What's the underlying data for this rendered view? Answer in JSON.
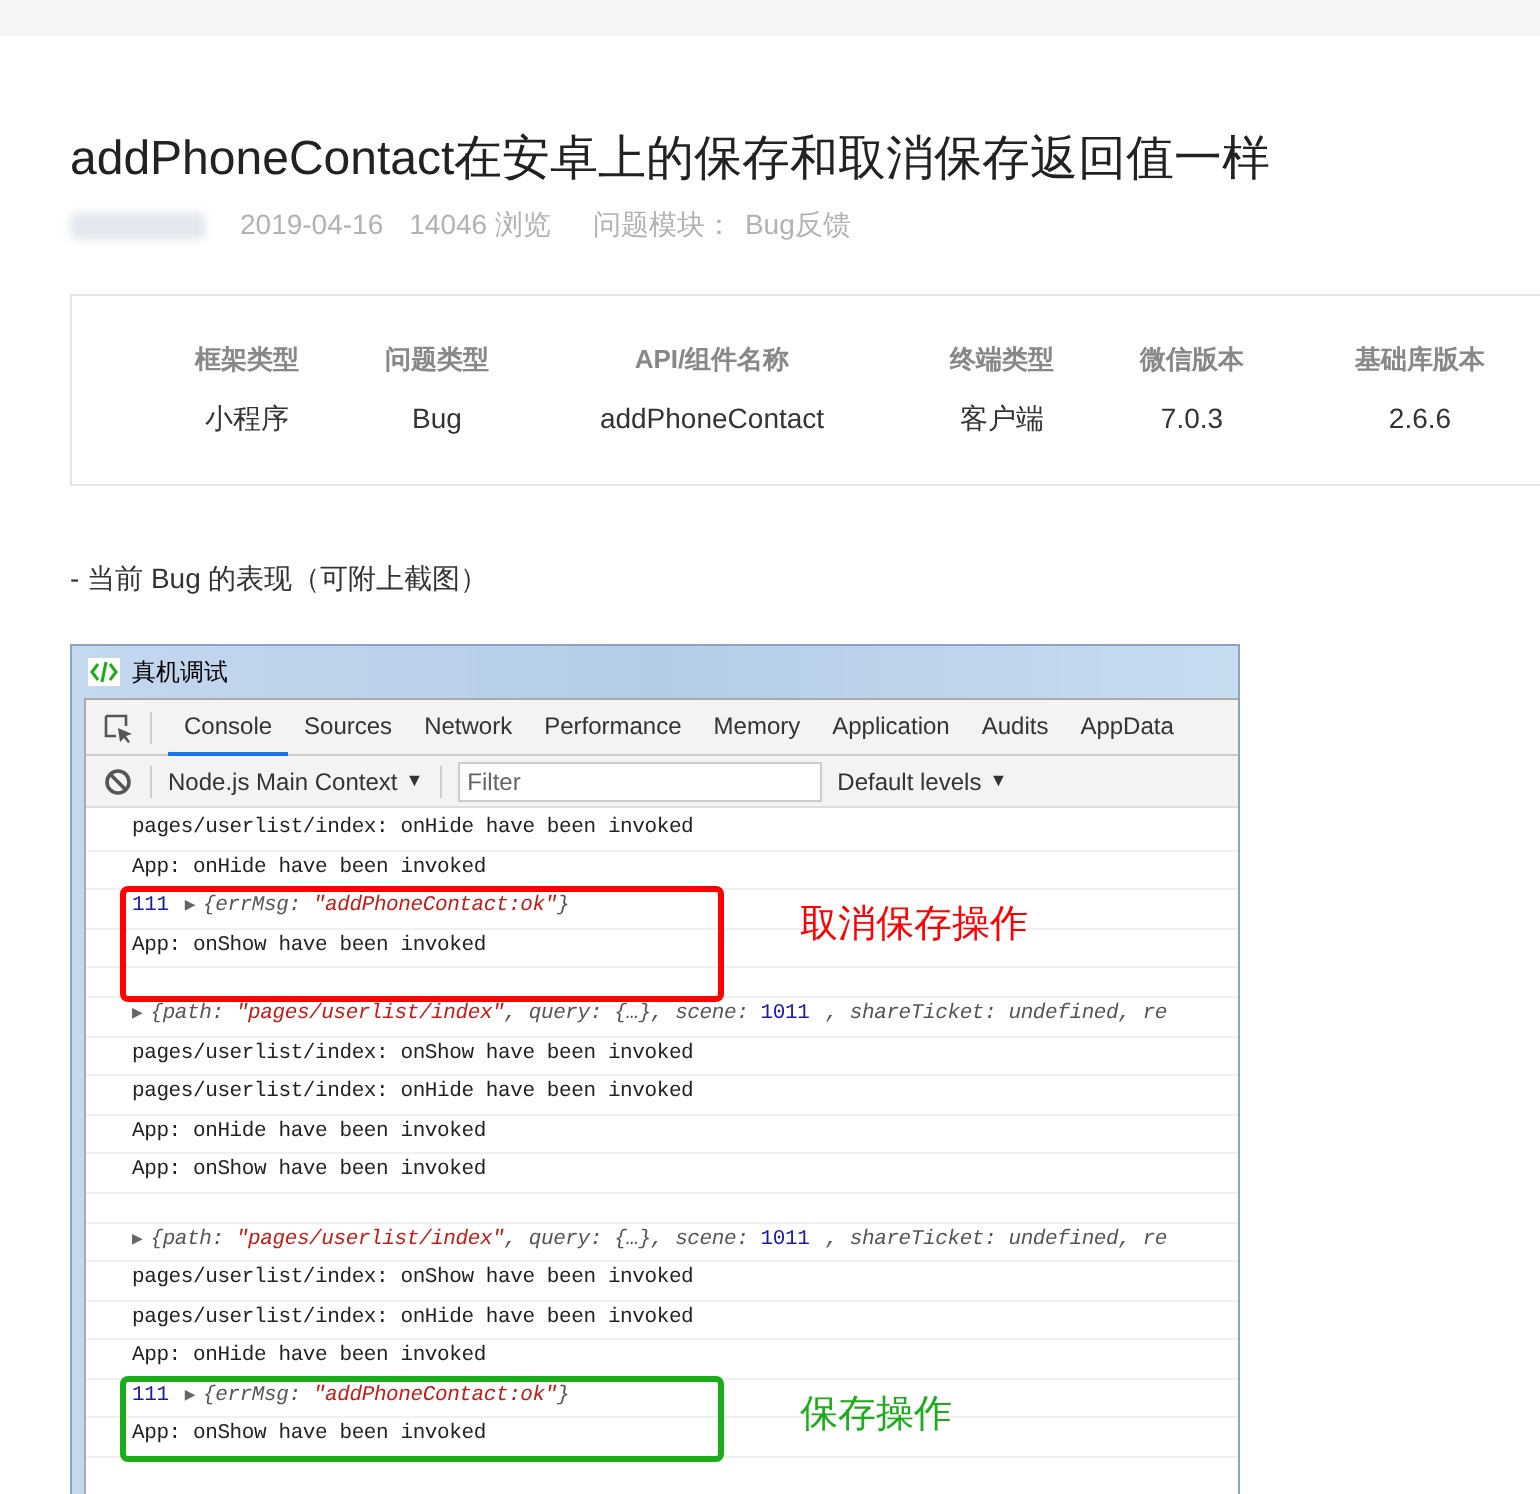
{
  "title": "addPhoneContact在安卓上的保存和取消保存返回值一样",
  "meta": {
    "date": "2019-04-16",
    "views": "14046 浏览",
    "module_label": "问题模块：",
    "module": "Bug反馈"
  },
  "info": [
    {
      "label": "框架类型",
      "value": "小程序"
    },
    {
      "label": "问题类型",
      "value": "Bug"
    },
    {
      "label": "API/组件名称",
      "value": "addPhoneContact"
    },
    {
      "label": "终端类型",
      "value": "客户端"
    },
    {
      "label": "微信版本",
      "value": "7.0.3"
    },
    {
      "label": "基础库版本",
      "value": "2.6.6"
    }
  ],
  "section": "- 当前 Bug 的表现（可附上截图）",
  "devtools": {
    "title": "真机调试",
    "tabs": [
      {
        "label": "Console",
        "selected": true
      },
      {
        "label": "Sources",
        "selected": false
      },
      {
        "label": "Network",
        "selected": false
      },
      {
        "label": "Performance",
        "selected": false
      },
      {
        "label": "Memory",
        "selected": false
      },
      {
        "label": "Application",
        "selected": false
      },
      {
        "label": "Audits",
        "selected": false
      },
      {
        "label": "AppData",
        "selected": false
      }
    ],
    "context": "Node.js Main Context",
    "dropdown_caret": "▼",
    "filter_placeholder": "Filter",
    "levels": "Default levels",
    "groups": [
      {
        "lines": [
          {
            "kind": "text",
            "segments": [
              {
                "kind": "plain",
                "text": "pages/userlist/index: onHide have been invoked"
              }
            ]
          },
          {
            "kind": "text",
            "segments": [
              {
                "kind": "plain",
                "text": "App: onHide have been invoked"
              }
            ]
          }
        ]
      },
      {
        "annotation": {
          "color": "#ff0000",
          "label": "取消保存操作"
        },
        "lines": [
          {
            "kind": "object",
            "segments": [
              {
                "kind": "number",
                "text": "111"
              },
              {
                "kind": "arrow",
                "text": "▶"
              },
              {
                "kind": "key",
                "text": "{errMsg: "
              },
              {
                "kind": "string",
                "text": "\"addPhoneContact:ok\""
              },
              {
                "kind": "key",
                "text": "}"
              }
            ]
          },
          {
            "kind": "text",
            "segments": [
              {
                "kind": "plain",
                "text": "App: onShow have been invoked"
              }
            ]
          },
          {
            "kind": "blank"
          }
        ]
      },
      {
        "lines": [
          {
            "kind": "object",
            "segments": [
              {
                "kind": "arrow",
                "text": "▶"
              },
              {
                "kind": "key",
                "text": "{path: "
              },
              {
                "kind": "string",
                "text": "\"pages/userlist/index\""
              },
              {
                "kind": "key",
                "text": ", query: {…}, scene: "
              },
              {
                "kind": "number",
                "text": "1011"
              },
              {
                "kind": "key",
                "text": ", shareTicket: undefined, re"
              }
            ]
          },
          {
            "kind": "text",
            "segments": [
              {
                "kind": "plain",
                "text": "pages/userlist/index: onShow have been invoked"
              }
            ]
          },
          {
            "kind": "text",
            "segments": [
              {
                "kind": "plain",
                "text": "pages/userlist/index: onHide have been invoked"
              }
            ]
          },
          {
            "kind": "text",
            "segments": [
              {
                "kind": "plain",
                "text": "App: onHide have been invoked"
              }
            ]
          },
          {
            "kind": "text",
            "segments": [
              {
                "kind": "plain",
                "text": "App: onShow have been invoked"
              }
            ]
          },
          {
            "kind": "blank"
          },
          {
            "kind": "object",
            "segments": [
              {
                "kind": "arrow",
                "text": "▶"
              },
              {
                "kind": "key",
                "text": "{path: "
              },
              {
                "kind": "string",
                "text": "\"pages/userlist/index\""
              },
              {
                "kind": "key",
                "text": ", query: {…}, scene: "
              },
              {
                "kind": "number",
                "text": "1011"
              },
              {
                "kind": "key",
                "text": ", shareTicket: undefined, re"
              }
            ]
          },
          {
            "kind": "text",
            "segments": [
              {
                "kind": "plain",
                "text": "pages/userlist/index: onShow have been invoked"
              }
            ]
          },
          {
            "kind": "text",
            "segments": [
              {
                "kind": "plain",
                "text": "pages/userlist/index: onHide have been invoked"
              }
            ]
          },
          {
            "kind": "text",
            "segments": [
              {
                "kind": "plain",
                "text": "App: onHide have been invoked"
              }
            ]
          }
        ]
      },
      {
        "annotation": {
          "color": "#1aad19",
          "label": "保存操作"
        },
        "lines": [
          {
            "kind": "object",
            "segments": [
              {
                "kind": "number",
                "text": "111"
              },
              {
                "kind": "arrow",
                "text": "▶"
              },
              {
                "kind": "key",
                "text": "{errMsg: "
              },
              {
                "kind": "string",
                "text": "\"addPhoneContact:ok\""
              },
              {
                "kind": "key",
                "text": "}"
              }
            ]
          },
          {
            "kind": "text",
            "segments": [
              {
                "kind": "plain",
                "text": "App: onShow have been invoked"
              }
            ]
          }
        ]
      }
    ]
  }
}
